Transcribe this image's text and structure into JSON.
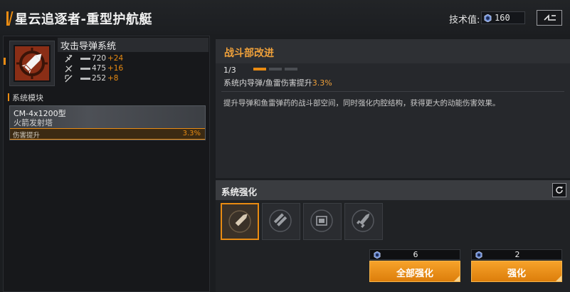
{
  "header": {
    "title": "星云追逐者-重型护航艇",
    "tech_label": "技术值:",
    "tech_value": "160",
    "back_icon": "return-arrow-icon"
  },
  "module": {
    "name": "攻击导弹系统",
    "icon": "missile-icon",
    "stats": [
      {
        "icon": "damage-icon",
        "value": "720",
        "delta": "+24"
      },
      {
        "icon": "range-icon",
        "value": "475",
        "delta": "+16"
      },
      {
        "icon": "reload-icon",
        "value": "252",
        "delta": "+8"
      }
    ]
  },
  "system_modules": {
    "label": "系统模块",
    "card": {
      "name": "CM-4x1200型",
      "subtitle": "火箭发射塔",
      "footer_label": "伤害提升",
      "footer_value": "3.3%"
    }
  },
  "upgrade": {
    "title": "战斗部改进",
    "level": "1/3",
    "level_filled": 1,
    "level_total": 3,
    "effect_prefix": "系统内导弹/鱼雷伤害提升",
    "effect_value": "3.3%",
    "description": "提升导弹和鱼雷弹药的战斗部空间，同时强化内腔结构，获得更大的动能伤害效果。"
  },
  "enhance": {
    "title": "系统强化",
    "refresh_icon": "refresh-icon",
    "slots": [
      {
        "icon": "missile-slot-icon",
        "active": true
      },
      {
        "icon": "launcher-slot-icon",
        "active": false
      },
      {
        "icon": "chip-slot-icon",
        "active": false
      },
      {
        "icon": "rocket-slot-icon",
        "active": false
      }
    ],
    "all_cost": "6",
    "all_label": "全部强化",
    "single_cost": "2",
    "single_label": "强化"
  },
  "colors": {
    "accent": "#e98b12",
    "highlight": "#f0a13a",
    "button": "#f6a22a"
  }
}
